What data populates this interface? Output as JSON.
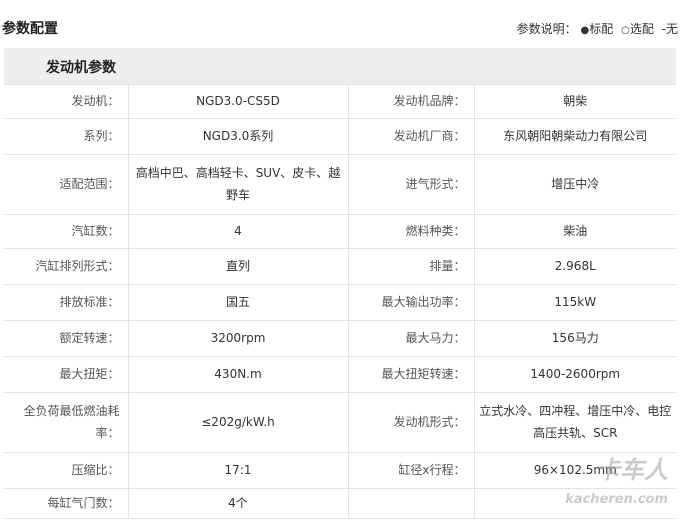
{
  "header": {
    "title": "参数配置",
    "legend_label": "参数说明：",
    "legend_standard_symbol": "●",
    "legend_standard": "标配",
    "legend_optional_symbol": "○",
    "legend_optional": "选配",
    "legend_none": "-无"
  },
  "section": {
    "title": "发动机参数"
  },
  "rows": [
    {
      "k1": "发动机：",
      "v1": "NGD3.0-CS5D",
      "k2": "发动机品牌：",
      "v2": "朝柴"
    },
    {
      "k1": "系列：",
      "v1": "NGD3.0系列",
      "k2": "发动机厂商：",
      "v2": "东风朝阳朝柴动力有限公司"
    },
    {
      "k1": "适配范围：",
      "v1": "高档中巴、高档轻卡、SUV、皮卡、越野车",
      "k2": "进气形式：",
      "v2": "增压中冷"
    },
    {
      "k1": "汽缸数：",
      "v1": "4",
      "k2": "燃料种类：",
      "v2": "柴油"
    },
    {
      "k1": "汽缸排列形式：",
      "v1": "直列",
      "k2": "排量：",
      "v2": "2.968L"
    },
    {
      "k1": "排放标准：",
      "v1": "国五",
      "k2": "最大输出功率：",
      "v2": "115kW"
    },
    {
      "k1": "额定转速：",
      "v1": "3200rpm",
      "k2": "最大马力：",
      "v2": "156马力"
    },
    {
      "k1": "最大扭矩：",
      "v1": "430N.m",
      "k2": "最大扭矩转速：",
      "v2": "1400-2600rpm"
    },
    {
      "k1": "全负荷最低燃油耗率：",
      "v1": "≤202g/kW.h",
      "k2": "发动机形式：",
      "v2": "立式水冷、四冲程、增压中冷、电控高压共轨、SCR"
    },
    {
      "k1": "压缩比：",
      "v1": "17:1",
      "k2": "缸径x行程：",
      "v2": "96×102.5mm"
    },
    {
      "k1": "每缸气门数：",
      "v1": "4个",
      "k2": "",
      "v2": ""
    }
  ],
  "watermark": {
    "brand": "卡车人",
    "site": "kacheren.com"
  }
}
